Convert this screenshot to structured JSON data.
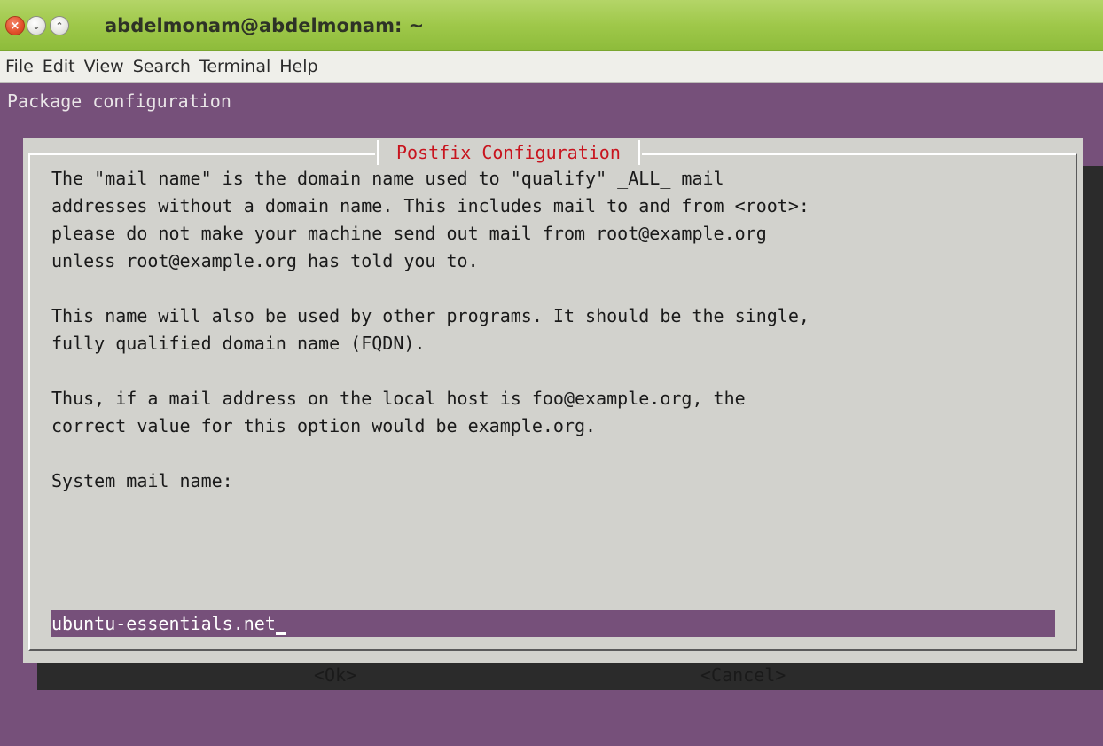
{
  "window": {
    "title": "abdelmonam@abdelmonam: ~",
    "buttons": {
      "close": "×",
      "minimize": "⌄",
      "maximize": "⌃"
    }
  },
  "menubar": {
    "items": [
      "File",
      "Edit",
      "View",
      "Search",
      "Terminal",
      "Help"
    ]
  },
  "terminal": {
    "header": "Package configuration",
    "dialog": {
      "title": "Postfix Configuration",
      "lines": [
        "The \"mail name\" is the domain name used to \"qualify\" _ALL_ mail",
        "addresses without a domain name. This includes mail to and from <root>:",
        "please do not make your machine send out mail from root@example.org",
        "unless root@example.org has told you to.",
        "",
        "This name will also be used by other programs. It should be the single,",
        "fully qualified domain name (FQDN).",
        "",
        "Thus, if a mail address on the local host is foo@example.org, the",
        "correct value for this option would be example.org.",
        "",
        "System mail name:"
      ],
      "input_value": "ubuntu-essentials.net",
      "ok_label": "<Ok>",
      "cancel_label": "<Cancel>"
    }
  },
  "colors": {
    "terminal_bg": "#76507a",
    "titlebar": "#9fc84a",
    "dialog_bg": "#d2d2cd",
    "dialog_title": "#c8141e"
  }
}
